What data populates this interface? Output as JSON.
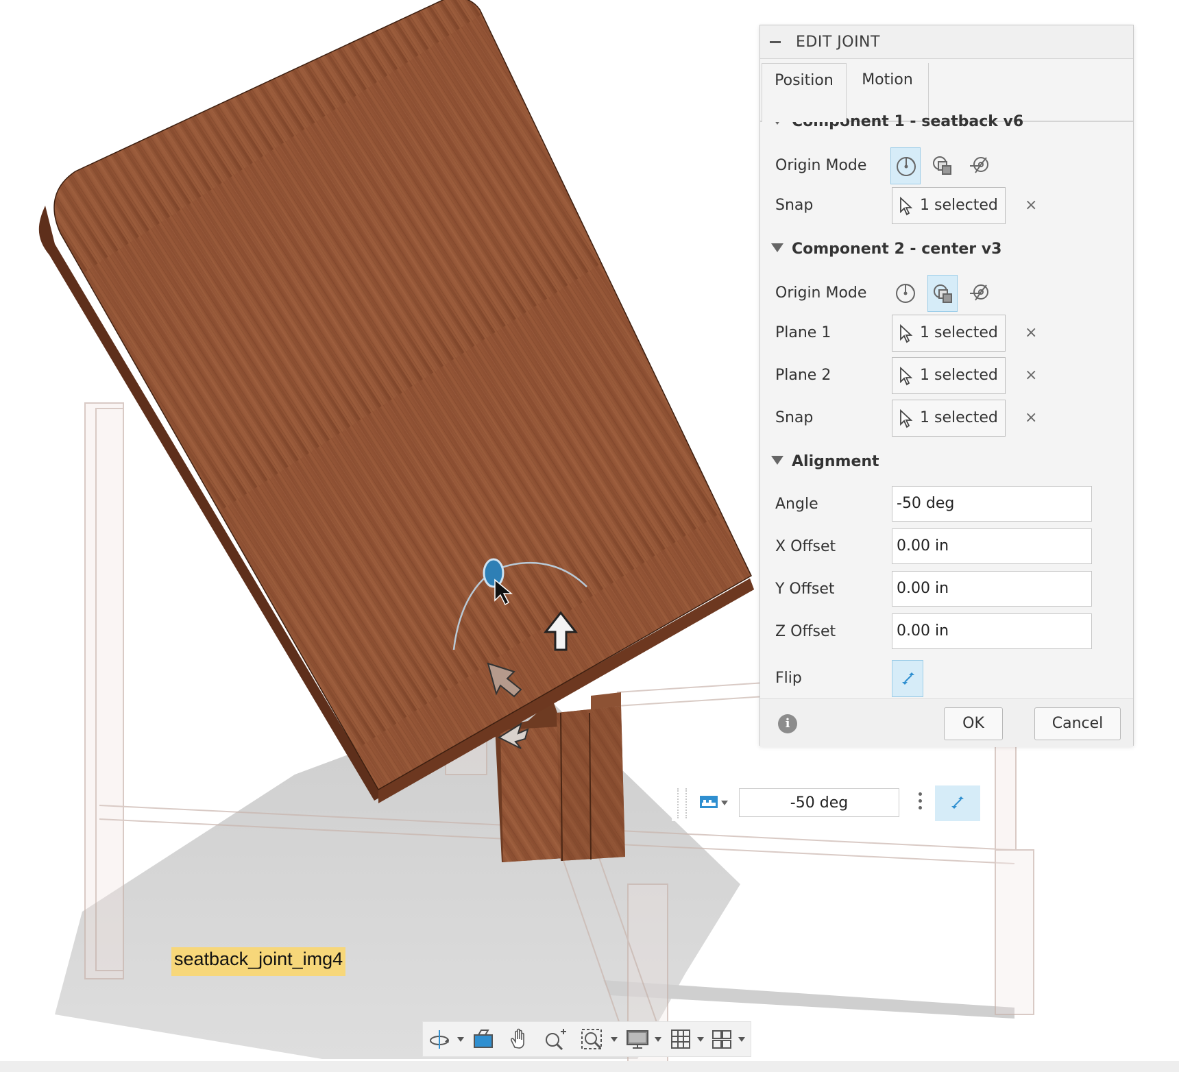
{
  "panel": {
    "title": "EDIT JOINT",
    "tabs": [
      "Position",
      "Motion"
    ],
    "component1": {
      "heading": "Component 1 - seatback v6",
      "origin_mode_label": "Origin Mode",
      "snap_label": "Snap",
      "snap_value": "1 selected"
    },
    "component2": {
      "heading": "Component 2 - center v3",
      "origin_mode_label": "Origin Mode",
      "plane1_label": "Plane 1",
      "plane1_value": "1 selected",
      "plane2_label": "Plane 2",
      "plane2_value": "1 selected",
      "snap_label": "Snap",
      "snap_value": "1 selected"
    },
    "alignment": {
      "heading": "Alignment",
      "angle_label": "Angle",
      "angle_value": "-50 deg",
      "x_label": "X Offset",
      "x_value": "0.00 in",
      "y_label": "Y Offset",
      "y_value": "0.00 in",
      "z_label": "Z Offset",
      "z_value": "0.00 in",
      "flip_label": "Flip"
    },
    "clear_symbol": "×",
    "ok_label": "OK",
    "cancel_label": "Cancel"
  },
  "angle_widget": {
    "value": "-50 deg"
  },
  "caption": "seatback_joint_img4",
  "colors": {
    "accent": "#2f8fd0",
    "active_bg": "#d6ecf8",
    "wood": "#8a4f32",
    "caption_bg": "#f7d77a"
  },
  "icons": {
    "origin_modes": [
      "simple-origin-icon",
      "between-two-faces-icon",
      "two-edge-intersection-icon"
    ],
    "toolbar": [
      "orbit-icon",
      "look-at-icon",
      "pan-icon",
      "zoom-icon",
      "fit-icon",
      "display-settings-icon",
      "grid-icon",
      "viewports-icon"
    ]
  }
}
